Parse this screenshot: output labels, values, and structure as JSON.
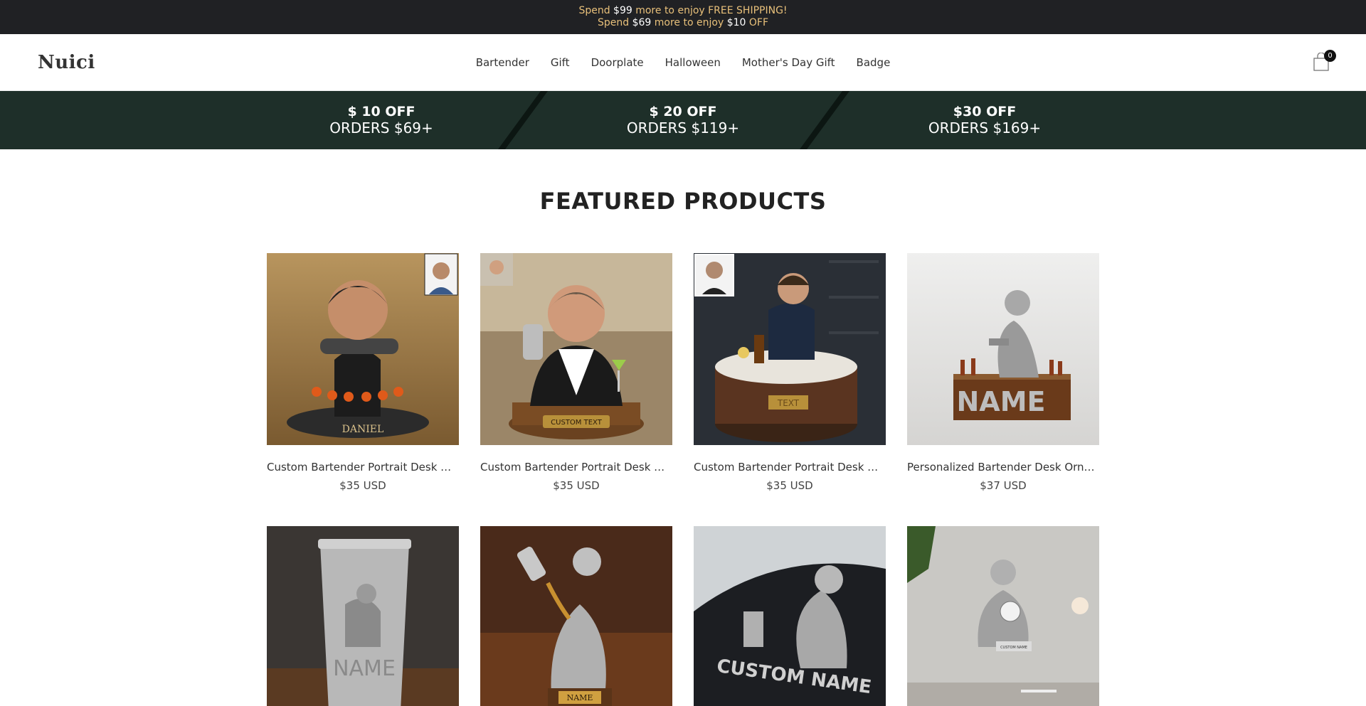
{
  "announcement": {
    "line1_pre": "Spend ",
    "line1_amount": "$99",
    "line1_post": " more to enjoy FREE SHIPPING!",
    "line2_pre": "Spend ",
    "line2_amount": "$69",
    "line2_mid": " more to enjoy ",
    "line2_amount2": "$10",
    "line2_post": " OFF"
  },
  "header": {
    "logo": "Nuici",
    "nav": [
      "Bartender",
      "Gift",
      "Doorplate",
      "Halloween",
      "Mother's Day Gift",
      "Badge"
    ],
    "cart_count": "0",
    "cart_icon": "shopping-bag-icon"
  },
  "promos": [
    {
      "title": "$ 10 OFF",
      "sub": "ORDERS $69+"
    },
    {
      "title": "$ 20 OFF",
      "sub": "ORDERS $119+"
    },
    {
      "title": "$30 OFF",
      "sub": "ORDERS $169+"
    }
  ],
  "featured": {
    "title": "FEATURED PRODUCTS",
    "products": [
      {
        "title": "Custom Bartender Portrait Desk Decor",
        "price": "$35 USD"
      },
      {
        "title": "Custom Bartender Portrait Desk Decor",
        "price": "$35 USD"
      },
      {
        "title": "Custom Bartender Portrait Desk Decor",
        "price": "$35 USD"
      },
      {
        "title": "Personalized Bartender Desk Ornament",
        "price": "$37 USD"
      },
      {
        "title": "",
        "price": ""
      },
      {
        "title": "",
        "price": ""
      },
      {
        "title": "",
        "price": ""
      },
      {
        "title": "",
        "price": ""
      }
    ],
    "image_text": {
      "p1": "DANIEL",
      "p2": "CUSTOM TEXT",
      "p3": "TEXT",
      "p4": "NAME",
      "p5": "NAME",
      "p6": "NAME",
      "p7": "CUSTOM NAME",
      "p8": "CUSTOM NAME"
    }
  },
  "colors": {
    "announce_bg": "#202124",
    "announce_text": "#e8c07a",
    "promo_bg": "#1e2f29"
  }
}
